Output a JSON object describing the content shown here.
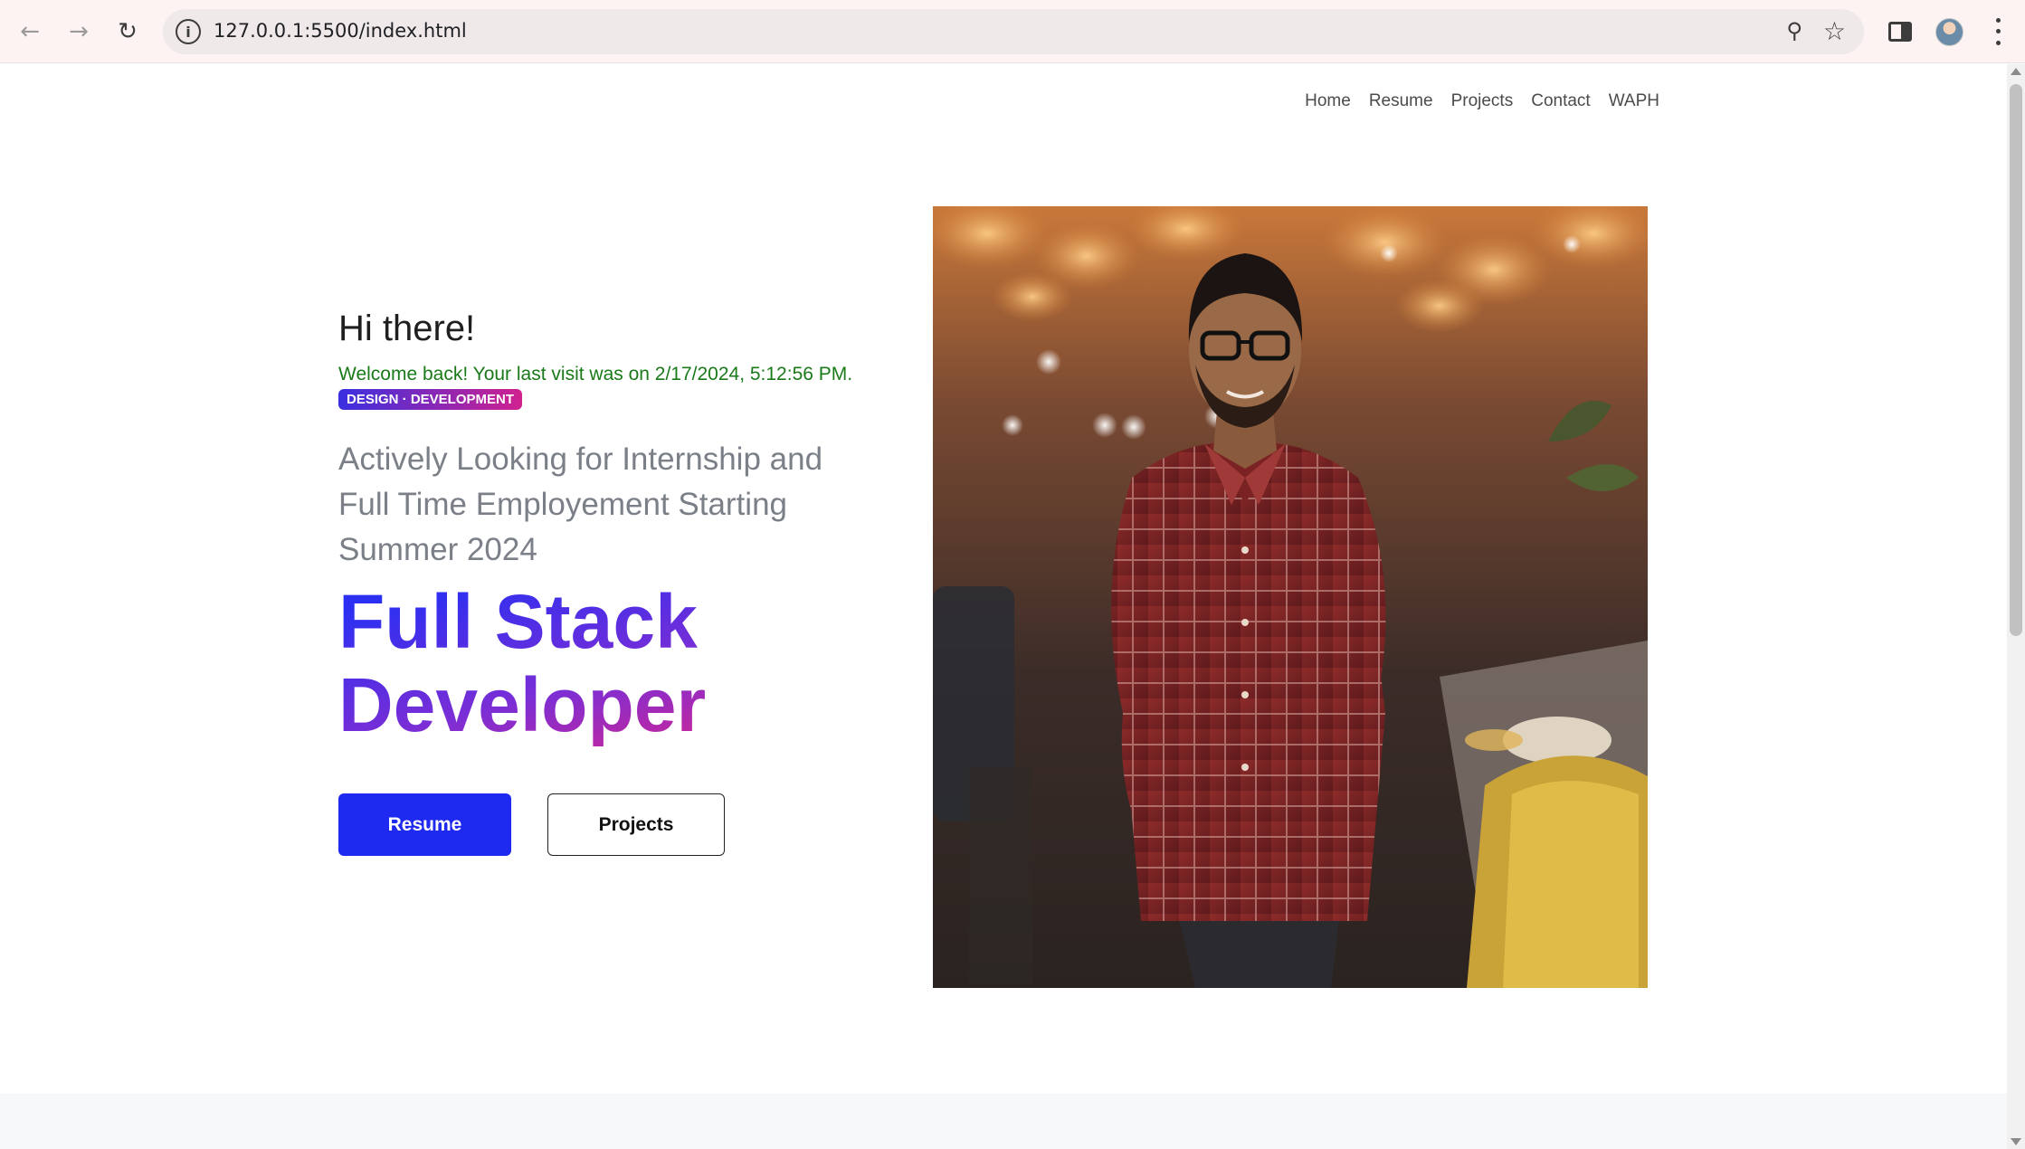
{
  "browser": {
    "url": "127.0.0.1:5500/index.html",
    "back_icon": "arrow-left-icon",
    "forward_icon": "arrow-right-icon",
    "reload_icon": "reload-icon",
    "site_info_icon": "info-icon",
    "site_info_glyph": "i",
    "zoom_icon": "zoom-icon",
    "bookmark_icon": "star-icon",
    "side_panel_icon": "side-panel-icon",
    "menu_icon": "kebab-menu-icon"
  },
  "nav": {
    "items": [
      "Home",
      "Resume",
      "Projects",
      "Contact",
      "WAPH"
    ]
  },
  "hero": {
    "greeting": "Hi there!",
    "welcome": "Welcome back! Your last visit was on 2/17/2024, 5:12:56 PM.",
    "badge": "DESIGN · DEVELOPMENT",
    "looking": "Actively Looking for Internship and Full Time Employement Starting Summer 2024",
    "title_line1": "Full Stack",
    "title_line2": "Developer",
    "primary_button": "Resume",
    "secondary_button": "Projects"
  },
  "colors": {
    "welcome_text": "#1a7a1a",
    "primary_button": "#1f2af0",
    "gradient_start": "#2a2ff2",
    "gradient_end": "#d62690"
  }
}
